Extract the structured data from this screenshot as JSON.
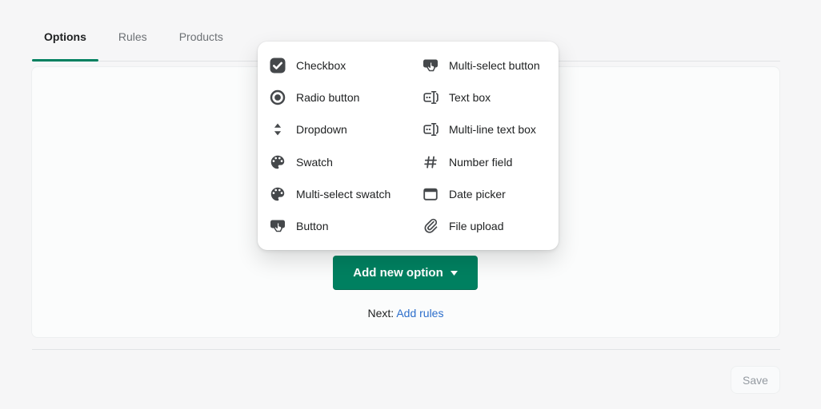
{
  "tabs": [
    {
      "label": "Options",
      "active": true
    },
    {
      "label": "Rules",
      "active": false
    },
    {
      "label": "Products",
      "active": false
    }
  ],
  "menu": {
    "columns": [
      [
        {
          "label": "Checkbox",
          "icon": "checkbox-icon"
        },
        {
          "label": "Radio button",
          "icon": "radio-icon"
        },
        {
          "label": "Dropdown",
          "icon": "dropdown-icon"
        },
        {
          "label": "Swatch",
          "icon": "swatch-icon"
        },
        {
          "label": "Multi-select swatch",
          "icon": "swatch-icon"
        },
        {
          "label": "Button",
          "icon": "button-icon"
        }
      ],
      [
        {
          "label": "Multi-select button",
          "icon": "button-icon"
        },
        {
          "label": "Text box",
          "icon": "textbox-icon"
        },
        {
          "label": "Multi-line text box",
          "icon": "textbox-icon"
        },
        {
          "label": "Number field",
          "icon": "number-icon"
        },
        {
          "label": "Date picker",
          "icon": "calendar-icon"
        },
        {
          "label": "File upload",
          "icon": "paperclip-icon"
        }
      ]
    ]
  },
  "actions": {
    "add_new_option": "Add new option",
    "next_label": "Next:",
    "next_link": "Add rules",
    "save": "Save"
  },
  "colors": {
    "primary_green": "#008060",
    "link_blue": "#2c6ecb",
    "icon_gray": "#45484b",
    "text_dark": "#202223",
    "text_muted": "#6d7175",
    "page_bg": "#f6f6f7",
    "divider": "#e1e3e5"
  }
}
